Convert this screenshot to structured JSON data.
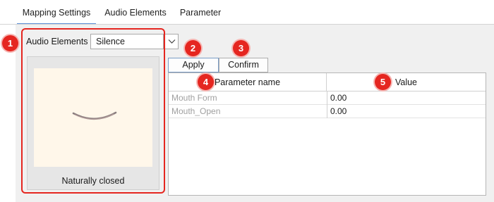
{
  "tabs": [
    {
      "label": "Mapping Settings",
      "active": true
    },
    {
      "label": "Audio Elements",
      "active": false
    },
    {
      "label": "Parameter",
      "active": false
    }
  ],
  "audio_elements": {
    "label": "Audio Elements :",
    "selected": "Silence"
  },
  "preview": {
    "caption": "Naturally closed",
    "icon": "closed-mouth-illustration"
  },
  "buttons": {
    "apply": "Apply",
    "confirm": "Confirm"
  },
  "table": {
    "headers": [
      "Parameter name",
      "Value"
    ],
    "rows": [
      {
        "name": "Mouth Form",
        "value": "0.00"
      },
      {
        "name": "Mouth_Open",
        "value": "0.00"
      }
    ]
  },
  "badges": [
    "1",
    "2",
    "3",
    "4",
    "5"
  ],
  "colors": {
    "badge": "#e52620",
    "highlight": "#e52620",
    "active_tab_underline": "#5b8fd6"
  }
}
